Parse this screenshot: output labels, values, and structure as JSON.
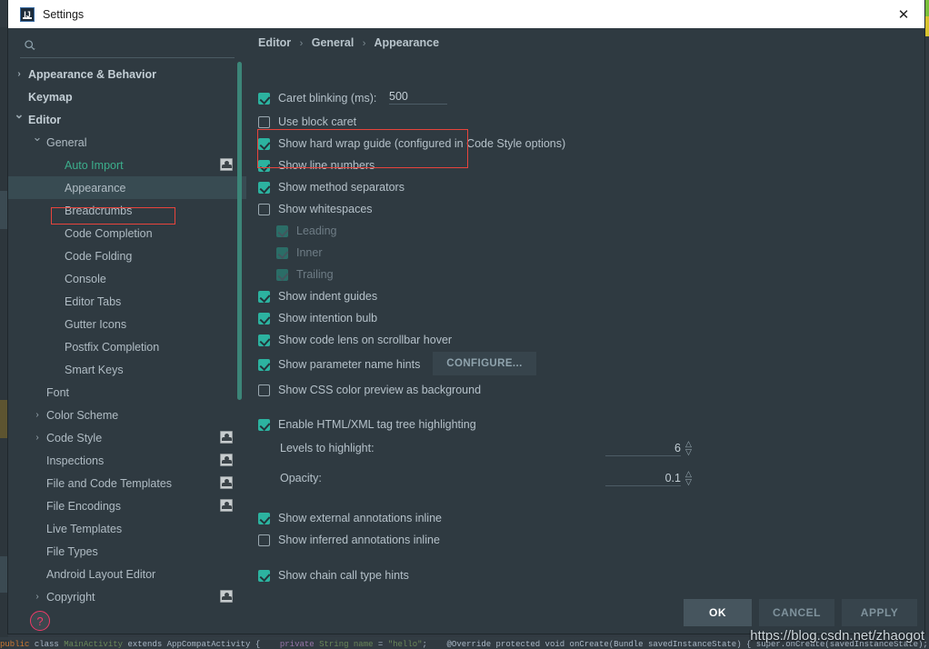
{
  "window": {
    "title": "Settings",
    "icon": "intellij-idea-icon",
    "close_label": "✕"
  },
  "sidebar": {
    "search": {
      "placeholder": "",
      "value": "",
      "icon": "search-icon"
    },
    "items": [
      {
        "label": "Appearance & Behavior",
        "indent": 0,
        "arrow": "collapsed",
        "bold": true,
        "selected": false,
        "link": false,
        "badge": false
      },
      {
        "label": "Keymap",
        "indent": 0,
        "arrow": "none",
        "bold": true,
        "selected": false,
        "link": false,
        "badge": false
      },
      {
        "label": "Editor",
        "indent": 0,
        "arrow": "expanded",
        "bold": true,
        "selected": false,
        "link": false,
        "badge": false
      },
      {
        "label": "General",
        "indent": 1,
        "arrow": "expanded",
        "bold": false,
        "selected": false,
        "link": false,
        "badge": false
      },
      {
        "label": "Auto Import",
        "indent": 2,
        "arrow": "none",
        "bold": false,
        "selected": false,
        "link": true,
        "badge": true
      },
      {
        "label": "Appearance",
        "indent": 2,
        "arrow": "none",
        "bold": false,
        "selected": true,
        "link": false,
        "badge": false
      },
      {
        "label": "Breadcrumbs",
        "indent": 2,
        "arrow": "none",
        "bold": false,
        "selected": false,
        "link": false,
        "badge": false
      },
      {
        "label": "Code Completion",
        "indent": 2,
        "arrow": "none",
        "bold": false,
        "selected": false,
        "link": false,
        "badge": false
      },
      {
        "label": "Code Folding",
        "indent": 2,
        "arrow": "none",
        "bold": false,
        "selected": false,
        "link": false,
        "badge": false
      },
      {
        "label": "Console",
        "indent": 2,
        "arrow": "none",
        "bold": false,
        "selected": false,
        "link": false,
        "badge": false
      },
      {
        "label": "Editor Tabs",
        "indent": 2,
        "arrow": "none",
        "bold": false,
        "selected": false,
        "link": false,
        "badge": false
      },
      {
        "label": "Gutter Icons",
        "indent": 2,
        "arrow": "none",
        "bold": false,
        "selected": false,
        "link": false,
        "badge": false
      },
      {
        "label": "Postfix Completion",
        "indent": 2,
        "arrow": "none",
        "bold": false,
        "selected": false,
        "link": false,
        "badge": false
      },
      {
        "label": "Smart Keys",
        "indent": 2,
        "arrow": "none",
        "bold": false,
        "selected": false,
        "link": false,
        "badge": false
      },
      {
        "label": "Font",
        "indent": 1,
        "arrow": "none",
        "bold": false,
        "selected": false,
        "link": false,
        "badge": false
      },
      {
        "label": "Color Scheme",
        "indent": 1,
        "arrow": "collapsed",
        "bold": false,
        "selected": false,
        "link": false,
        "badge": false
      },
      {
        "label": "Code Style",
        "indent": 1,
        "arrow": "collapsed",
        "bold": false,
        "selected": false,
        "link": false,
        "badge": true
      },
      {
        "label": "Inspections",
        "indent": 1,
        "arrow": "none",
        "bold": false,
        "selected": false,
        "link": false,
        "badge": true
      },
      {
        "label": "File and Code Templates",
        "indent": 1,
        "arrow": "none",
        "bold": false,
        "selected": false,
        "link": false,
        "badge": true
      },
      {
        "label": "File Encodings",
        "indent": 1,
        "arrow": "none",
        "bold": false,
        "selected": false,
        "link": false,
        "badge": true
      },
      {
        "label": "Live Templates",
        "indent": 1,
        "arrow": "none",
        "bold": false,
        "selected": false,
        "link": false,
        "badge": false
      },
      {
        "label": "File Types",
        "indent": 1,
        "arrow": "none",
        "bold": false,
        "selected": false,
        "link": false,
        "badge": false
      },
      {
        "label": "Android Layout Editor",
        "indent": 1,
        "arrow": "none",
        "bold": false,
        "selected": false,
        "link": false,
        "badge": false
      },
      {
        "label": "Copyright",
        "indent": 1,
        "arrow": "collapsed",
        "bold": false,
        "selected": false,
        "link": false,
        "badge": true
      }
    ],
    "help_label": "?",
    "help_icon": "help-circle-icon"
  },
  "breadcrumb": {
    "part1": "Editor",
    "part2": "General",
    "part3": "Appearance",
    "separator": "›"
  },
  "settings": {
    "caret_blinking": {
      "label": "Caret blinking (ms):",
      "checked": true,
      "value": "500"
    },
    "use_block_caret": {
      "label": "Use block caret",
      "checked": false
    },
    "show_hard_wrap_guide": {
      "label": "Show hard wrap guide (configured in Code Style options)",
      "checked": true
    },
    "show_line_numbers": {
      "label": "Show line numbers",
      "checked": true
    },
    "show_method_separators": {
      "label": "Show method separators",
      "checked": true
    },
    "show_whitespaces": {
      "label": "Show whitespaces",
      "checked": false
    },
    "leading": {
      "label": "Leading",
      "checked": true,
      "disabled": true
    },
    "inner": {
      "label": "Inner",
      "checked": true,
      "disabled": true
    },
    "trailing": {
      "label": "Trailing",
      "checked": true,
      "disabled": true
    },
    "show_indent_guides": {
      "label": "Show indent guides",
      "checked": true
    },
    "show_intention_bulb": {
      "label": "Show intention bulb",
      "checked": true
    },
    "show_code_lens": {
      "label": "Show code lens on scrollbar hover",
      "checked": true
    },
    "show_parameter_name_hints": {
      "label": "Show parameter name hints",
      "checked": true
    },
    "configure_button": "CONFIGURE...",
    "show_css_color_preview": {
      "label": "Show CSS color preview as background",
      "checked": false
    },
    "enable_tag_tree_highlighting": {
      "label": "Enable HTML/XML tag tree highlighting",
      "checked": true
    },
    "levels_to_highlight": {
      "label": "Levels to highlight:",
      "value": "6"
    },
    "opacity": {
      "label": "Opacity:",
      "value": "0.1"
    },
    "show_external_annotations": {
      "label": "Show external annotations inline",
      "checked": true
    },
    "show_inferred_annotations": {
      "label": "Show inferred annotations inline",
      "checked": false
    },
    "show_chain_call_type_hints": {
      "label": "Show chain call type hints",
      "checked": true
    }
  },
  "buttons": {
    "ok": "OK",
    "cancel": "CANCEL",
    "apply": "APPLY"
  },
  "watermark": "https://blog.csdn.net/zhaogot",
  "colors": {
    "accent_teal": "#2cb3a0",
    "highlight_red": "#e8443c",
    "link_green": "#3cae8c",
    "panel_bg": "#2f3a41",
    "selected_row": "#384b52"
  }
}
